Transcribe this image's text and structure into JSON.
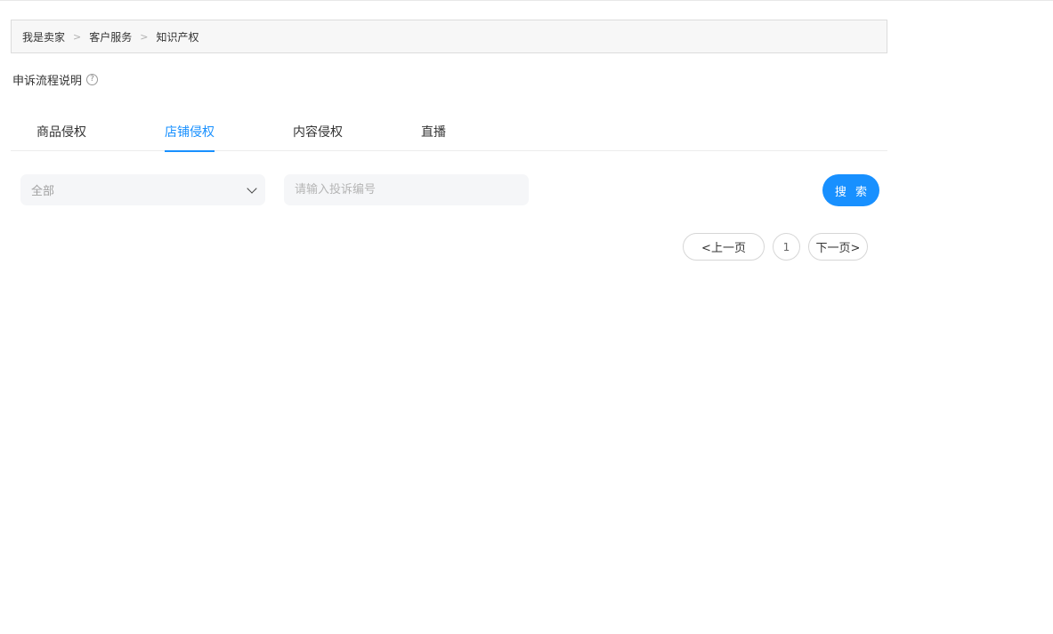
{
  "breadcrumb": {
    "items": [
      "我是卖家",
      "客户服务",
      "知识产权"
    ],
    "separator": ">"
  },
  "help": {
    "label": "申诉流程说明",
    "icon": "question-circle-icon",
    "icon_glyph": "?"
  },
  "tabs": [
    {
      "label": "商品侵权",
      "active": false
    },
    {
      "label": "店铺侵权",
      "active": true
    },
    {
      "label": "内容侵权",
      "active": false
    },
    {
      "label": "直播",
      "active": false
    }
  ],
  "filter": {
    "selected": "全部",
    "icon": "chevron-down-icon"
  },
  "search": {
    "placeholder": "请输入投诉编号",
    "value": "",
    "button_label": "搜 索"
  },
  "pagination": {
    "prev_label": "<上一页",
    "current_page": "1",
    "next_label": "下一页>"
  },
  "colors": {
    "accent": "#1890ff",
    "breadcrumb_bg": "#f7f7f7",
    "input_bg": "#f5f6f8"
  }
}
